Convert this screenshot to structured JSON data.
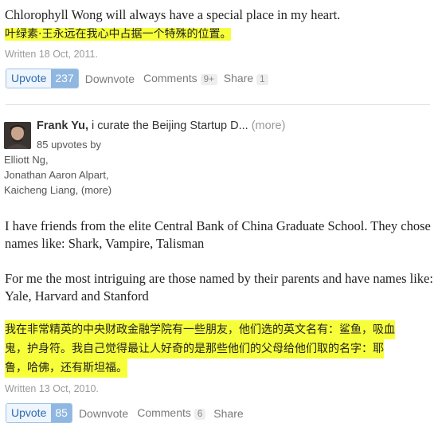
{
  "answer1": {
    "english": "Chlorophyll Wong will always have a special place in my heart.",
    "chinese": "叶绿素·王永远在我心中占据一个特殊的位置。",
    "written": "Written 18 Oct, 2011.",
    "actions": {
      "upvote_label": "Upvote",
      "upvote_count": "237",
      "downvote_label": "Downvote",
      "comments_label": "Comments",
      "comments_count": "9+",
      "share_label": "Share",
      "share_count": "1"
    }
  },
  "answer2": {
    "author_name": "Frank Yu,",
    "author_bio": " i curate the Beijing Startup D...",
    "author_more": " (more)",
    "upvotes_line": "85 upvotes by",
    "upvoter_1": "Elliott Ng,",
    "upvoter_2": "Jonathan Aaron Alpart,",
    "upvoter_3": "Kaicheng Liang,",
    "upvoters_more": " (more)",
    "paragraph1": "I have friends from the elite Central Bank of China Graduate School. They chose names like: Shark, Vampire, Talisman",
    "paragraph2": "For me the most intriguing  are those named by their parents and have names like: Yale, Harvard and Stanford",
    "chinese_line1": "我在非常精英的中央财政金融学院有一些朋友，他们选的英文名有：鲨鱼，吸血",
    "chinese_line2": "鬼，护身符。我自己觉得最让人好奇的是那些他们的父母给他们取的名字：耶",
    "chinese_line3": "鲁，哈佛，还有斯坦福。",
    "written": "Written 13 Oct, 2010.",
    "actions": {
      "upvote_label": "Upvote",
      "upvote_count": "85",
      "downvote_label": "Downvote",
      "comments_label": "Comments",
      "comments_count": "6",
      "share_label": "Share"
    }
  }
}
